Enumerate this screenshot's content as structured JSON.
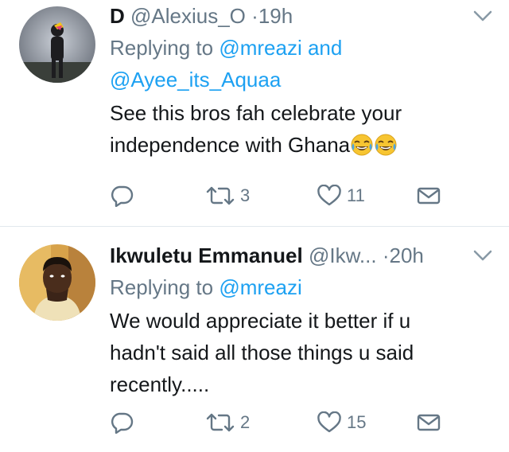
{
  "tweets": [
    {
      "display_name": "D",
      "handle": "@Alexius_O",
      "separator": "·",
      "time": "19h",
      "replying_prefix": "Replying to ",
      "mentions": [
        "@mreazi",
        "@Ayee_its_Aquaa"
      ],
      "mention_joiner": " and",
      "text_lines": [
        "See this bros fah celebrate your",
        "independence with Ghana"
      ],
      "emoji": [
        "face-with-tears-of-joy",
        "face-with-tears-of-joy"
      ],
      "retweets": "3",
      "likes": "11"
    },
    {
      "display_name": "Ikwuletu Emmanuel",
      "handle": "@Ikw...",
      "separator": "·",
      "time": "20h",
      "replying_prefix": "Replying to ",
      "mentions": [
        "@mreazi"
      ],
      "text_lines": [
        "We would appreciate it better if u",
        "hadn't said all those things u said",
        "recently....."
      ],
      "retweets": "2",
      "likes": "15"
    }
  ],
  "colors": {
    "accent": "#1da1f2",
    "secondary_text": "#657786",
    "primary_text": "#14171a",
    "divider": "#e1e8ed"
  },
  "icons": [
    "reply-icon",
    "retweet-icon",
    "like-icon",
    "direct-message-icon",
    "chevron-down-icon"
  ]
}
